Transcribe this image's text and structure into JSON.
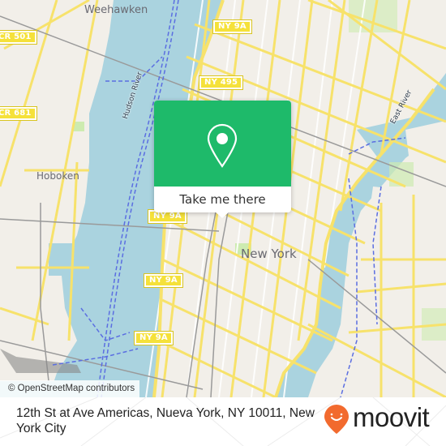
{
  "map": {
    "places": [
      {
        "id": "weehawken",
        "label": "Weehawken"
      },
      {
        "id": "hoboken",
        "label": "Hoboken"
      },
      {
        "id": "new-york",
        "label": "New York"
      }
    ],
    "water_labels": [
      {
        "id": "hudson-river",
        "label": "Hudson River"
      },
      {
        "id": "east-river",
        "label": "East River"
      }
    ],
    "route_shields": [
      {
        "id": "cr-501",
        "label": "CR 501"
      },
      {
        "id": "cr-681",
        "label": "CR 681"
      },
      {
        "id": "ny-9a-top",
        "label": "NY 9A"
      },
      {
        "id": "ny-495",
        "label": "NY 495"
      },
      {
        "id": "ny-9a-1",
        "label": "NY 9A"
      },
      {
        "id": "ny-9a-2",
        "label": "NY 9A"
      },
      {
        "id": "ny-9a-3",
        "label": "NY 9A"
      }
    ],
    "attribution": "© OpenStreetMap contributors",
    "colors": {
      "land": "#f2efe9",
      "water": "#aad3df",
      "road_major": "#f7e26b",
      "road_minor": "#ffffff",
      "ferry": "#5b6ee1",
      "rail": "#999999",
      "park": "#cdebb0"
    }
  },
  "popup": {
    "icon": "map-pin-icon",
    "cta_label": "Take me there",
    "color": "#1eba6a"
  },
  "footer": {
    "address": "12th St at Ave Americas, Nueva York, NY 10011, New York City",
    "brand": "moovit",
    "brand_color": "#f26a2e"
  }
}
